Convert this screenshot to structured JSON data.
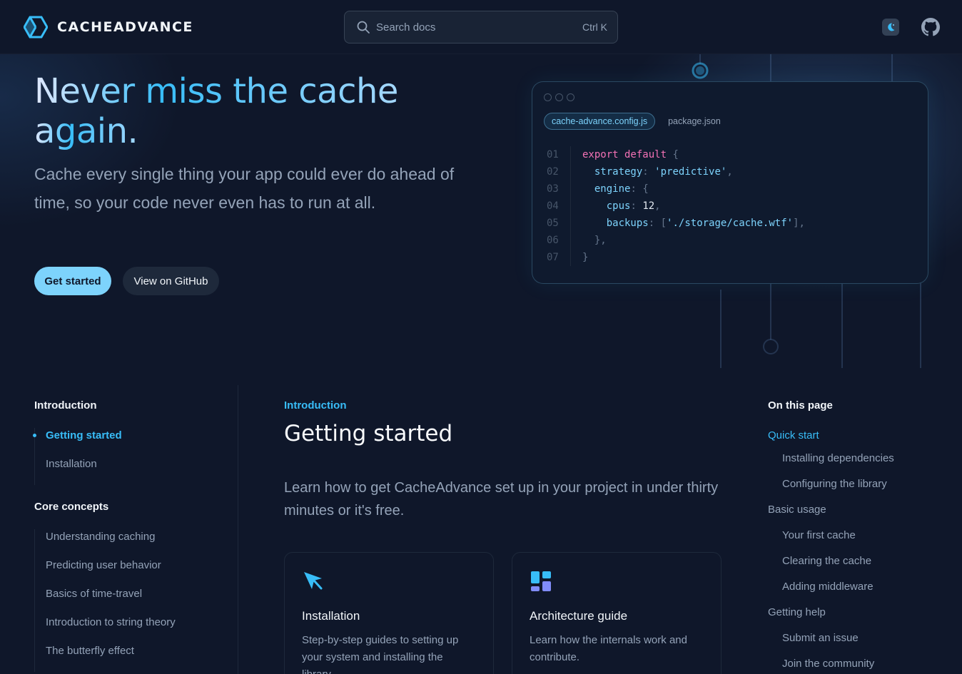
{
  "header": {
    "brand": "CACHEADVANCE",
    "search_placeholder": "Search docs",
    "search_shortcut": "Ctrl K"
  },
  "hero": {
    "title_line1": "Never miss the cache",
    "title_line2": "again.",
    "subtitle": "Cache every single thing your app could ever do ahead of time, so your code never even has to run at all.",
    "primary_button": "Get started",
    "secondary_button": "View on GitHub"
  },
  "code_card": {
    "tabs": [
      "cache-advance.config.js",
      "package.json"
    ],
    "lines": [
      {
        "num": "01",
        "text": "export default {"
      },
      {
        "num": "02",
        "text": "strategy: 'predictive',"
      },
      {
        "num": "03",
        "text": "engine: {"
      },
      {
        "num": "04",
        "text": "cpus: 12,"
      },
      {
        "num": "05",
        "text": "backups: ['./storage/cache.wtf'],"
      },
      {
        "num": "06",
        "text": "},"
      },
      {
        "num": "07",
        "text": "}"
      }
    ]
  },
  "leftnav": {
    "sections": [
      {
        "title": "Introduction",
        "items": [
          "Getting started",
          "Installation"
        ]
      },
      {
        "title": "Core concepts",
        "items": [
          "Understanding caching",
          "Predicting user behavior",
          "Basics of time-travel",
          "Introduction to string theory",
          "The butterfly effect"
        ]
      }
    ],
    "active_item": "Getting started"
  },
  "main": {
    "eyebrow": "Introduction",
    "title": "Getting started",
    "lead": "Learn how to get CacheAdvance set up in your project in under thirty minutes or it's free.",
    "cards": [
      {
        "title": "Installation",
        "desc": "Step-by-step guides to setting up your system and installing the library."
      },
      {
        "title": "Architecture guide",
        "desc": "Learn how the internals work and contribute."
      }
    ]
  },
  "toc": {
    "heading": "On this page",
    "items": [
      {
        "label": "Quick start",
        "level": 1,
        "active": true
      },
      {
        "label": "Installing dependencies",
        "level": 2
      },
      {
        "label": "Configuring the library",
        "level": 2
      },
      {
        "label": "Basic usage",
        "level": 1
      },
      {
        "label": "Your first cache",
        "level": 2
      },
      {
        "label": "Clearing the cache",
        "level": 2
      },
      {
        "label": "Adding middleware",
        "level": 2
      },
      {
        "label": "Getting help",
        "level": 1
      },
      {
        "label": "Submit an issue",
        "level": 2
      },
      {
        "label": "Join the community",
        "level": 2
      }
    ]
  },
  "colors": {
    "background": "#0f172a",
    "accent": "#38bdf8",
    "primary_button": "#7dd3fc",
    "keyword": "#f472b6"
  }
}
